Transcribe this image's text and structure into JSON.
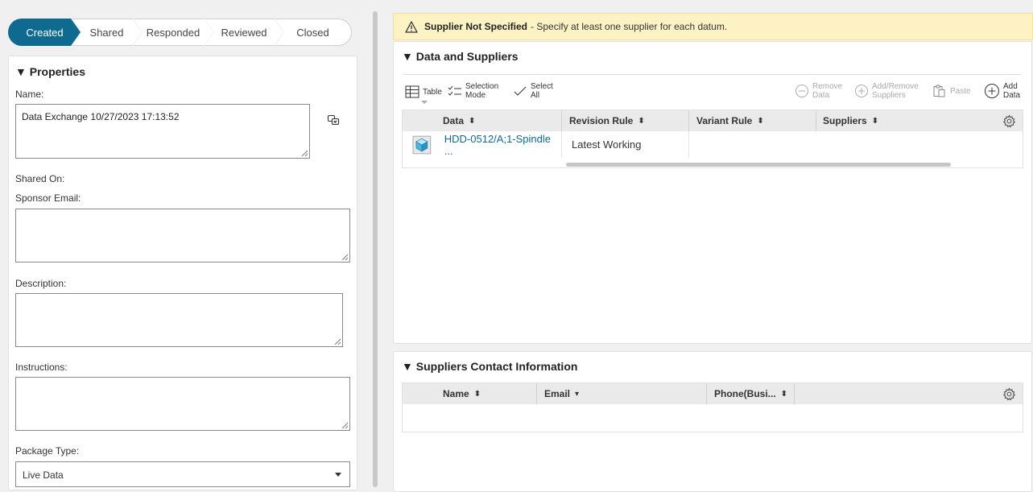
{
  "stepper": {
    "steps": [
      {
        "label": "Created",
        "active": true
      },
      {
        "label": "Shared"
      },
      {
        "label": "Responded"
      },
      {
        "label": "Reviewed"
      },
      {
        "label": "Closed"
      }
    ]
  },
  "properties": {
    "title": "Properties",
    "name_label": "Name:",
    "name_value": "Data Exchange 10/27/2023 17:13:52",
    "shared_on_label": "Shared On:",
    "sponsor_email_label": "Sponsor Email:",
    "description_label": "Description:",
    "instructions_label": "Instructions:",
    "package_type_label": "Package Type:",
    "package_type_value": "Live Data"
  },
  "warning": {
    "title": "Supplier Not Specified",
    "message": "- Specify at least one supplier for each datum."
  },
  "data_suppliers": {
    "title": "Data and Suppliers",
    "toolbar": {
      "table": "Table",
      "selection_mode_1": "Selection",
      "selection_mode_2": "Mode",
      "select_all_1": "Select",
      "select_all_2": "All",
      "remove_data_1": "Remove",
      "remove_data_2": "Data",
      "add_remove_suppliers_1": "Add/Remove",
      "add_remove_suppliers_2": "Suppliers",
      "paste": "Paste",
      "add_data_1": "Add",
      "add_data_2": "Data"
    },
    "columns": [
      "Data",
      "Revision Rule",
      "Variant Rule",
      "Suppliers"
    ],
    "rows": [
      {
        "data": "HDD-0512/A;1-Spindle ...",
        "revision_rule": "Latest Working",
        "variant_rule": "",
        "suppliers": ""
      }
    ]
  },
  "contacts": {
    "title": "Suppliers Contact Information",
    "columns": [
      "Name",
      "Email",
      "Phone(Busi..."
    ]
  },
  "colors": {
    "accent": "#0f6a8f",
    "warning_bg": "#fdf2c4"
  }
}
